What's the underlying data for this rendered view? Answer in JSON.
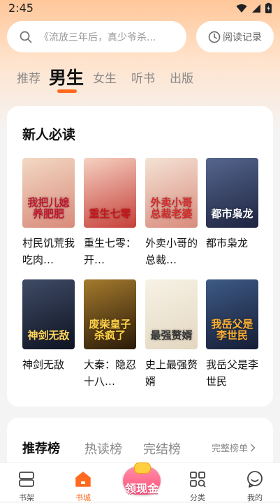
{
  "status_bar": {
    "time": "2:45"
  },
  "search": {
    "placeholder": "《流放三年后，真少爷杀..."
  },
  "history_button": {
    "label": "阅读记录"
  },
  "category_tabs": [
    {
      "label": "推荐",
      "active": false
    },
    {
      "label": "男生",
      "active": true
    },
    {
      "label": "女生",
      "active": false
    },
    {
      "label": "听书",
      "active": false
    },
    {
      "label": "出版",
      "active": false
    }
  ],
  "new_reader_section": {
    "title": "新人必读",
    "books": [
      {
        "title": "村民饥荒我吃肉…",
        "cover_text": "我把儿媳养肥肥",
        "cover_colors": [
          "#f2d9c4",
          "#d98a7a"
        ],
        "cover_text_color": "#c1172e"
      },
      {
        "title": "重生七零：开…",
        "cover_text": "重生七零",
        "cover_colors": [
          "#f5d2c2",
          "#c6403a"
        ],
        "cover_text_color": "#c4161c"
      },
      {
        "title": "外卖小哥的总裁…",
        "cover_text": "外卖小哥总裁老婆",
        "cover_colors": [
          "#f4e3d5",
          "#d88c7d"
        ],
        "cover_text_color": "#d42a2a"
      },
      {
        "title": "都市枭龙",
        "cover_text": "都市枭龙",
        "cover_colors": [
          "#55668e",
          "#1e2440"
        ],
        "cover_text_color": "#ffffff"
      },
      {
        "title": "神剑无敌",
        "cover_text": "神剑无敌",
        "cover_colors": [
          "#3f4b66",
          "#0e1322"
        ],
        "cover_text_color": "#ffd45a"
      },
      {
        "title": "大秦：隐忍十八…",
        "cover_text": "废柴皇子杀疯了",
        "cover_colors": [
          "#a47a2d",
          "#2a1a08"
        ],
        "cover_text_color": "#ffd24a"
      },
      {
        "title": "史上最强赘婿",
        "cover_text": "最强赘婿",
        "cover_colors": [
          "#f7f2e6",
          "#e3d7c0"
        ],
        "cover_text_color": "#333333"
      },
      {
        "title": "我岳父是李世民",
        "cover_text": "我岳父是李世民",
        "cover_colors": [
          "#3e5a86",
          "#151d35"
        ],
        "cover_text_color": "#ffb02e"
      }
    ]
  },
  "ranking_section": {
    "tabs": [
      {
        "label": "推荐榜",
        "active": true
      },
      {
        "label": "热读榜",
        "active": false
      },
      {
        "label": "完结榜",
        "active": false
      }
    ],
    "more_label": "完整榜单"
  },
  "bottom_nav": [
    {
      "label": "书架",
      "icon": "bookshelf-icon",
      "active": false
    },
    {
      "label": "书城",
      "icon": "home-icon",
      "active": true
    },
    {
      "label": "",
      "icon": "cash-icon",
      "active": false
    },
    {
      "label": "分类",
      "icon": "category-icon",
      "active": false
    },
    {
      "label": "我的",
      "icon": "profile-icon",
      "active": false
    }
  ],
  "cash_badge": {
    "label": "领现金"
  },
  "colors": {
    "accent": "#ff6a1f",
    "header_gradient_top": "#ffc79a"
  }
}
